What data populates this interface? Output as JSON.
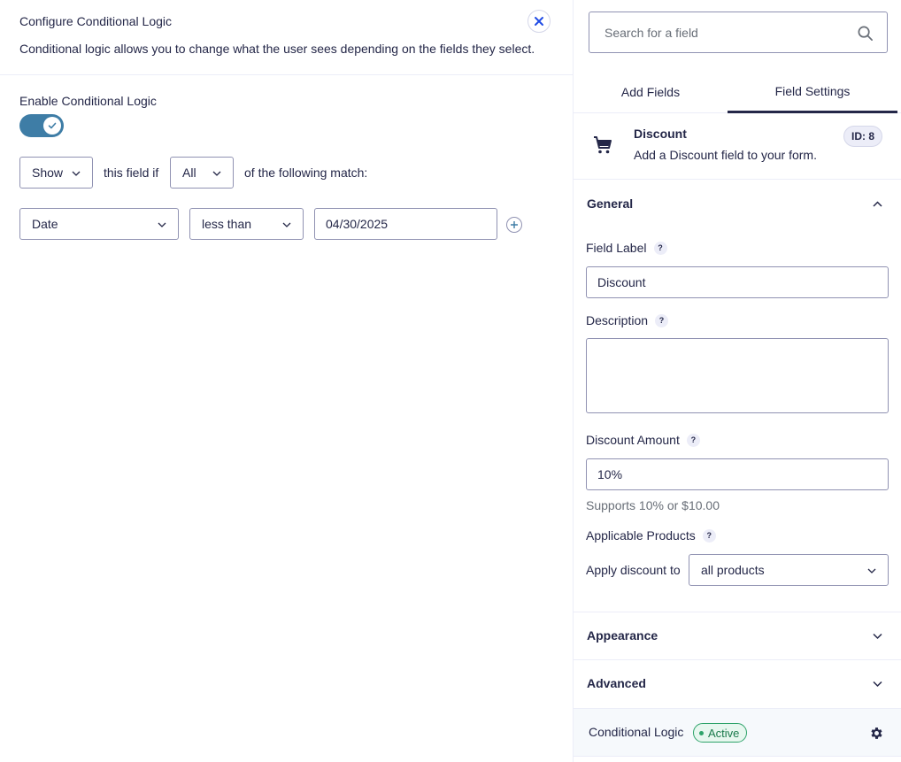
{
  "left_panel": {
    "title": "Configure Conditional Logic",
    "description": "Conditional logic allows you to change what the user sees depending on the fields they select.",
    "enable_label": "Enable Conditional Logic",
    "enabled": true,
    "action_select": "Show",
    "text_this_field_if": "this field if",
    "match_select": "All",
    "text_of_following": "of the following match:",
    "rule": {
      "field": "Date",
      "operator": "less than",
      "value": "04/30/2025"
    }
  },
  "right_panel": {
    "search_placeholder": "Search for a field",
    "tabs": [
      {
        "label": "Add Fields",
        "active": false
      },
      {
        "label": "Field Settings",
        "active": true
      }
    ],
    "field": {
      "name": "Discount",
      "description": "Add a Discount field to your form.",
      "id_badge": "ID: 8",
      "icon": "cart-icon"
    },
    "general": {
      "title": "General",
      "field_label_label": "Field Label",
      "field_label_value": "Discount",
      "description_label": "Description",
      "description_value": "",
      "discount_amount_label": "Discount Amount",
      "discount_amount_value": "10%",
      "discount_hint": "Supports 10% or $10.00",
      "applicable_products_label": "Applicable Products",
      "apply_discount_label": "Apply discount to",
      "apply_discount_value": "all products",
      "help_mark": "?"
    },
    "appearance_title": "Appearance",
    "advanced_title": "Advanced",
    "conditional_logic": {
      "label": "Conditional Logic",
      "status": "Active"
    }
  },
  "colors": {
    "text": "#242748",
    "border": "#9092b2",
    "toggle_on": "#3e7da6",
    "active_green": "#2ea36a"
  }
}
